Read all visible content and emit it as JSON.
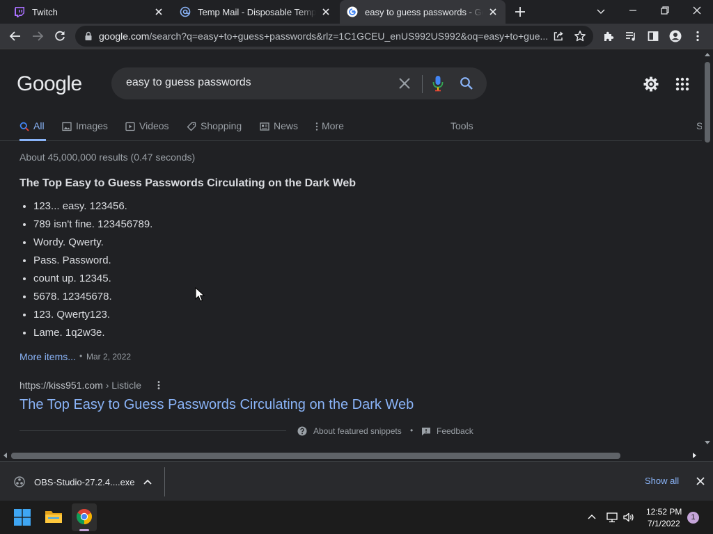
{
  "browser": {
    "tabs": [
      {
        "title": "Twitch",
        "icon": "twitch-icon"
      },
      {
        "title": "Temp Mail - Disposable Temporary Email",
        "icon": "at-icon"
      },
      {
        "title": "easy to guess passwords - Google Search",
        "icon": "google-g-icon",
        "active": true
      }
    ],
    "url_host": "google.com",
    "url_path": "/search?q=easy+to+guess+passwords&rlz=1C1GCEU_enUS992US992&oq=easy+to+gue..."
  },
  "search": {
    "logo": "Google",
    "query": "easy to guess passwords",
    "tabs": [
      "All",
      "Images",
      "Videos",
      "Shopping",
      "News",
      "More"
    ],
    "tools": "Tools",
    "cutoff_tab": "S",
    "stats": "About 45,000,000 results (0.47 seconds)"
  },
  "snippet": {
    "title": "The Top Easy to Guess Passwords Circulating on the Dark Web",
    "items": [
      "123... easy. 123456.",
      "789 isn't fine. 123456789.",
      "Wordy. Qwerty.",
      "Pass. Password.",
      "count up. 12345.",
      "5678. 12345678.",
      "123. Qwerty123.",
      "Lame. 1q2w3e."
    ],
    "more_items": "More items...",
    "separator": "•",
    "date": "Mar 2, 2022",
    "source_url": "https://kiss951.com",
    "source_crumb": " › Listicle",
    "result_title": "The Top Easy to Guess Passwords Circulating on the Dark Web",
    "about": "About featured snippets",
    "feedback": "Feedback"
  },
  "downloads": {
    "file": "OBS-Studio-27.2.4....exe",
    "show_all": "Show all"
  },
  "taskbar": {
    "time": "12:52 PM",
    "date": "7/1/2022",
    "notifications": "1"
  },
  "colors": {
    "page_bg": "#202124",
    "link": "#8ab4f8",
    "text": "#dadce0",
    "muted": "#9aa0a6"
  }
}
